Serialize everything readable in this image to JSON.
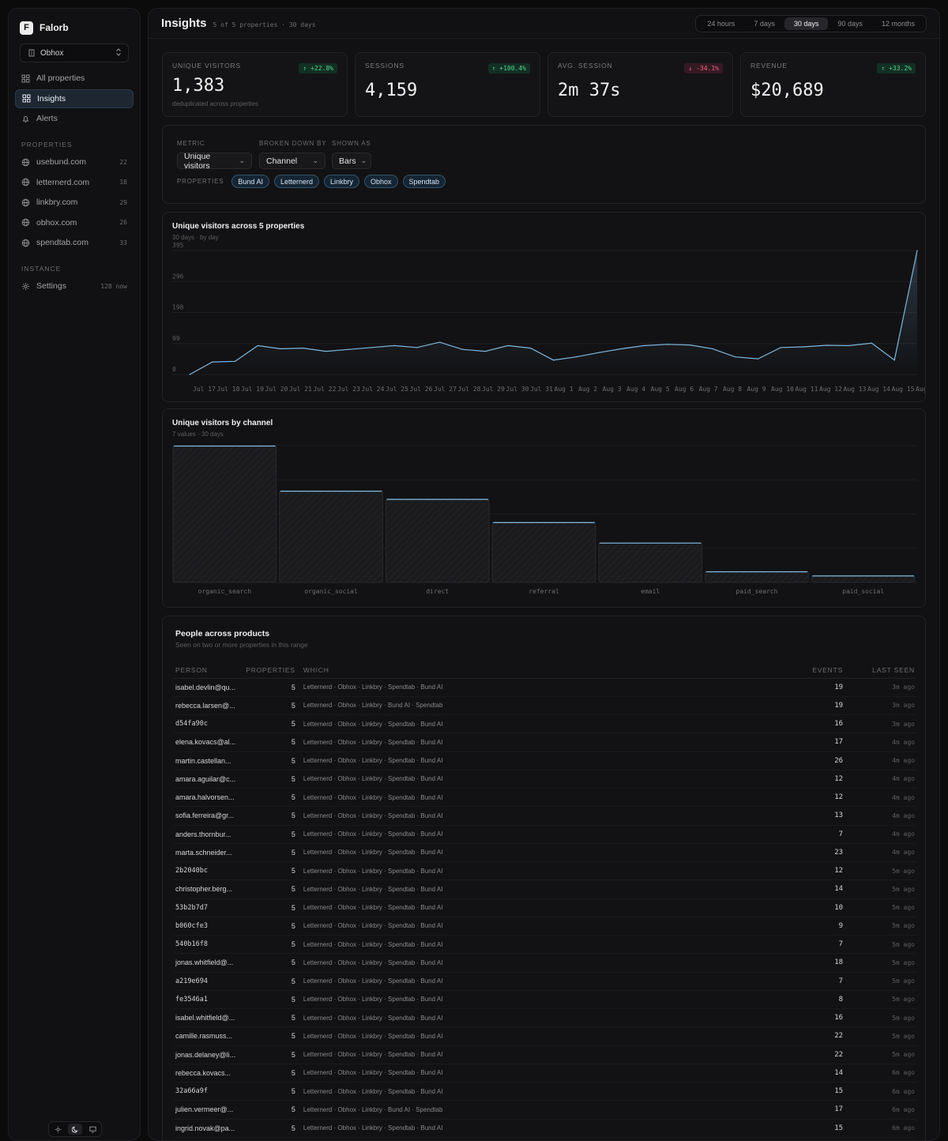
{
  "app": {
    "name": "Falorb",
    "logo_letter": "F"
  },
  "workspace": {
    "name": "Obhox"
  },
  "nav": [
    {
      "label": "All properties",
      "icon": "grid-icon"
    },
    {
      "label": "Insights",
      "icon": "grid-icon",
      "active": true
    },
    {
      "label": "Alerts",
      "icon": "bell-icon"
    }
  ],
  "properties_section": {
    "title": "PROPERTIES",
    "items": [
      {
        "label": "usebund.com",
        "count": "22"
      },
      {
        "label": "letternerd.com",
        "count": "18"
      },
      {
        "label": "linkbry.com",
        "count": "29"
      },
      {
        "label": "obhox.com",
        "count": "26"
      },
      {
        "label": "spendtab.com",
        "count": "33"
      }
    ]
  },
  "instance_section": {
    "title": "INSTANCE",
    "items": [
      {
        "label": "Settings",
        "count": "128 now"
      }
    ]
  },
  "header": {
    "title": "Insights",
    "subtitle": "5 of 5 properties · 30 days",
    "ranges": [
      "24 hours",
      "7 days",
      "30 days",
      "90 days",
      "12 months"
    ],
    "active_range": "30 days"
  },
  "kpis": [
    {
      "label": "UNIQUE VISITORS",
      "value": "1,383",
      "delta": "↑ +22.8%",
      "trend": "up",
      "note": "deduplicated across properties"
    },
    {
      "label": "SESSIONS",
      "value": "4,159",
      "delta": "↑ +100.4%",
      "trend": "up",
      "note": ""
    },
    {
      "label": "AVG. SESSION",
      "value": "2m 37s",
      "delta": "↓ -34.1%",
      "trend": "down",
      "note": ""
    },
    {
      "label": "REVENUE",
      "value": "$20,689",
      "delta": "↑ +33.2%",
      "trend": "up",
      "note": ""
    }
  ],
  "controls": {
    "metric_label": "METRIC",
    "metric_value": "Unique visitors",
    "breakdown_label": "BROKEN DOWN BY",
    "breakdown_value": "Channel",
    "shown_label": "SHOWN AS",
    "shown_value": "Bars",
    "properties_label": "PROPERTIES",
    "property_chips": [
      "Bund AI",
      "Letternerd",
      "Linkbry",
      "Obhox",
      "Spendtab"
    ]
  },
  "chart_data": [
    {
      "type": "area",
      "title": "Unique visitors across 5 properties",
      "subtitle": "30 days · by day",
      "x": [
        "Jul 17",
        "Jul 18",
        "Jul 19",
        "Jul 20",
        "Jul 21",
        "Jul 22",
        "Jul 23",
        "Jul 24",
        "Jul 25",
        "Jul 26",
        "Jul 27",
        "Jul 28",
        "Jul 29",
        "Jul 30",
        "Jul 31",
        "Aug 1",
        "Aug 2",
        "Aug 3",
        "Aug 4",
        "Aug 5",
        "Aug 6",
        "Aug 7",
        "Aug 8",
        "Aug 9",
        "Aug 10",
        "Aug 11",
        "Aug 12",
        "Aug 13",
        "Aug 14",
        "Aug 15",
        "Aug 16"
      ],
      "values": [
        0,
        40,
        42,
        92,
        82,
        84,
        74,
        80,
        86,
        92,
        86,
        103,
        80,
        74,
        92,
        84,
        46,
        56,
        70,
        82,
        92,
        96,
        94,
        82,
        56,
        50,
        86,
        88,
        93,
        92,
        100,
        46,
        395
      ],
      "yticks": [
        "0",
        "99",
        "198",
        "296",
        "395"
      ],
      "ylim": [
        0,
        395
      ],
      "grid": true
    },
    {
      "type": "bar",
      "title": "Unique visitors by channel",
      "subtitle": "7 values · 30 days",
      "categories": [
        "organic_search",
        "organic_social",
        "direct",
        "referral",
        "email",
        "paid_search",
        "paid_social"
      ],
      "values": [
        100,
        67,
        61,
        44,
        29,
        8,
        5
      ],
      "grid": true
    }
  ],
  "people": {
    "title": "People across products",
    "subtitle": "Seen on two or more properties in this range",
    "columns": {
      "person": "PERSON",
      "properties": "PROPERTIES",
      "which": "WHICH",
      "events": "EVENTS",
      "last_seen": "LAST SEEN"
    },
    "rows": [
      {
        "person": "isabel.devlin@qu...",
        "properties": "5",
        "which": "Letternerd · Obhox · Linkbry · Spendtab · Bund AI",
        "events": "19",
        "last_seen": "3m ago"
      },
      {
        "person": "rebecca.larsen@...",
        "properties": "5",
        "which": "Letternerd · Obhox · Linkbry · Bund AI · Spendtab",
        "events": "19",
        "last_seen": "3m ago"
      },
      {
        "person": "d54fa90c",
        "mono": true,
        "properties": "5",
        "which": "Letternerd · Obhox · Linkbry · Spendtab · Bund AI",
        "events": "16",
        "last_seen": "3m ago"
      },
      {
        "person": "elena.kovacs@al...",
        "properties": "5",
        "which": "Letternerd · Obhox · Linkbry · Spendtab · Bund AI",
        "events": "17",
        "last_seen": "4m ago"
      },
      {
        "person": "martin.castellan...",
        "properties": "5",
        "which": "Letternerd · Obhox · Linkbry · Spendtab · Bund AI",
        "events": "26",
        "last_seen": "4m ago"
      },
      {
        "person": "amara.aguilar@c...",
        "properties": "5",
        "which": "Letternerd · Obhox · Linkbry · Spendtab · Bund AI",
        "events": "12",
        "last_seen": "4m ago"
      },
      {
        "person": "amara.halvorsen...",
        "properties": "5",
        "which": "Letternerd · Obhox · Linkbry · Spendtab · Bund AI",
        "events": "12",
        "last_seen": "4m ago"
      },
      {
        "person": "sofia.ferreira@gr...",
        "properties": "5",
        "which": "Letternerd · Obhox · Linkbry · Spendtab · Bund AI",
        "events": "13",
        "last_seen": "4m ago"
      },
      {
        "person": "anders.thornbur...",
        "properties": "5",
        "which": "Letternerd · Obhox · Linkbry · Spendtab · Bund AI",
        "events": "7",
        "last_seen": "4m ago"
      },
      {
        "person": "marta.schneider...",
        "properties": "5",
        "which": "Letternerd · Obhox · Linkbry · Spendtab · Bund AI",
        "events": "23",
        "last_seen": "4m ago"
      },
      {
        "person": "2b2040bc",
        "mono": true,
        "properties": "5",
        "which": "Letternerd · Obhox · Linkbry · Spendtab · Bund AI",
        "events": "12",
        "last_seen": "5m ago"
      },
      {
        "person": "christopher.berg...",
        "properties": "5",
        "which": "Letternerd · Obhox · Linkbry · Spendtab · Bund AI",
        "events": "14",
        "last_seen": "5m ago"
      },
      {
        "person": "53b2b7d7",
        "mono": true,
        "properties": "5",
        "which": "Letternerd · Obhox · Linkbry · Spendtab · Bund AI",
        "events": "10",
        "last_seen": "5m ago"
      },
      {
        "person": "b060cfe3",
        "mono": true,
        "properties": "5",
        "which": "Letternerd · Obhox · Linkbry · Spendtab · Bund AI",
        "events": "9",
        "last_seen": "5m ago"
      },
      {
        "person": "540b16f8",
        "mono": true,
        "properties": "5",
        "which": "Letternerd · Obhox · Linkbry · Spendtab · Bund AI",
        "events": "7",
        "last_seen": "5m ago"
      },
      {
        "person": "jonas.whitfield@...",
        "properties": "5",
        "which": "Letternerd · Obhox · Linkbry · Spendtab · Bund AI",
        "events": "18",
        "last_seen": "5m ago"
      },
      {
        "person": "a219e694",
        "mono": true,
        "properties": "5",
        "which": "Letternerd · Obhox · Linkbry · Spendtab · Bund AI",
        "events": "7",
        "last_seen": "5m ago"
      },
      {
        "person": "fe3546a1",
        "mono": true,
        "properties": "5",
        "which": "Letternerd · Obhox · Linkbry · Spendtab · Bund AI",
        "events": "8",
        "last_seen": "5m ago"
      },
      {
        "person": "isabel.whitfield@...",
        "properties": "5",
        "which": "Letternerd · Obhox · Linkbry · Spendtab · Bund AI",
        "events": "16",
        "last_seen": "5m ago"
      },
      {
        "person": "camille.rasmuss...",
        "properties": "5",
        "which": "Letternerd · Obhox · Linkbry · Spendtab · Bund AI",
        "events": "22",
        "last_seen": "5m ago"
      },
      {
        "person": "jonas.delaney@li...",
        "properties": "5",
        "which": "Letternerd · Obhox · Linkbry · Spendtab · Bund AI",
        "events": "22",
        "last_seen": "5m ago"
      },
      {
        "person": "rebecca.kovacs...",
        "properties": "5",
        "which": "Letternerd · Obhox · Linkbry · Spendtab · Bund AI",
        "events": "14",
        "last_seen": "6m ago"
      },
      {
        "person": "32a66a9f",
        "mono": true,
        "properties": "5",
        "which": "Letternerd · Obhox · Linkbry · Spendtab · Bund AI",
        "events": "15",
        "last_seen": "6m ago"
      },
      {
        "person": "julien.vermeer@...",
        "properties": "5",
        "which": "Letternerd · Obhox · Linkbry · Bund AI · Spendtab",
        "events": "17",
        "last_seen": "6m ago"
      },
      {
        "person": "ingrid.novak@pa...",
        "properties": "5",
        "which": "Letternerd · Obhox · Linkbry · Spendtab · Bund AI",
        "events": "15",
        "last_seen": "6m ago"
      }
    ]
  },
  "colors": {
    "accent": "#7fb8dc",
    "up": "#55d48c",
    "down": "#ef6a86"
  }
}
